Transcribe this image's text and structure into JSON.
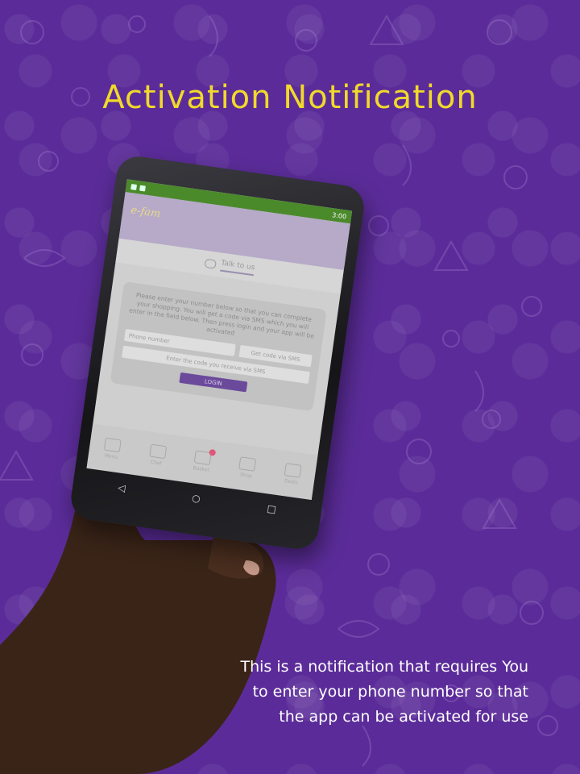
{
  "headline": "Activation Notification",
  "caption": {
    "line1": "This is a notification that requires You",
    "line2": "to enter your phone number so that",
    "line3": "the app can be activated for use"
  },
  "colors": {
    "background": "#5b2c99",
    "headline": "#f1d92b",
    "status_bar": "#4b8a2b",
    "login_button": "#6b4a9c"
  },
  "phone_screen": {
    "status_time": "3:00",
    "app_logo": "e-fam",
    "tab": {
      "label": "Talk to us",
      "icon": "chat-icon"
    },
    "card": {
      "message": "Please enter your number below so that you can complete your shopping. You will get a code via SMS which you will enter in the field below. Then press login and your app will be activated",
      "phone_placeholder": "Phone number",
      "get_code_label": "Get code via SMS",
      "code_placeholder": "Enter the code you receive via SMS",
      "login_label": "LOGIN"
    },
    "bottom_nav": [
      {
        "label": "Menu",
        "icon": "menu-icon"
      },
      {
        "label": "Chef",
        "icon": "chef-icon"
      },
      {
        "label": "Basket",
        "icon": "basket-icon"
      },
      {
        "label": "Shop",
        "icon": "cart-icon"
      },
      {
        "label": "Deals",
        "icon": "tag-icon"
      }
    ],
    "soft_keys": [
      "back-icon",
      "home-icon",
      "recent-apps-icon"
    ]
  }
}
